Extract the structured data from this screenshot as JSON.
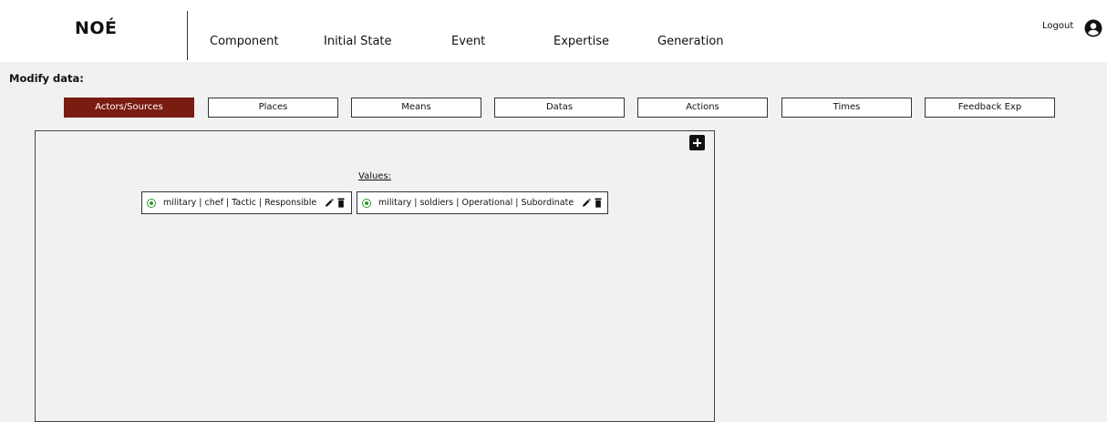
{
  "app": {
    "logo": "NOÉ"
  },
  "nav": {
    "items": [
      {
        "label": "Component"
      },
      {
        "label": "Initial State"
      },
      {
        "label": "Event"
      },
      {
        "label": "Expertise"
      },
      {
        "label": "Generation"
      }
    ],
    "logout_label": "Logout",
    "user_icon": "user-circle-icon"
  },
  "page": {
    "title": "Modify data:"
  },
  "tabs": [
    {
      "label": "Actors/Sources",
      "active": true
    },
    {
      "label": "Places",
      "active": false
    },
    {
      "label": "Means",
      "active": false
    },
    {
      "label": "Datas",
      "active": false
    },
    {
      "label": "Actions",
      "active": false
    },
    {
      "label": "Times",
      "active": false
    },
    {
      "label": "Feedback Exp",
      "active": false
    }
  ],
  "panel": {
    "add_icon": "plus-square-icon",
    "values_label": "Values:",
    "values": [
      {
        "text": "military | chef | Tactic | Responsible",
        "selected": true
      },
      {
        "text": "military | soldiers | Operational | Subordinate",
        "selected": true
      }
    ]
  },
  "colors": {
    "active_tab": "#7b1c11",
    "radio_selected": "#2d9a2d",
    "page_background": "#f1f1f1",
    "header_background": "#ffffff"
  }
}
